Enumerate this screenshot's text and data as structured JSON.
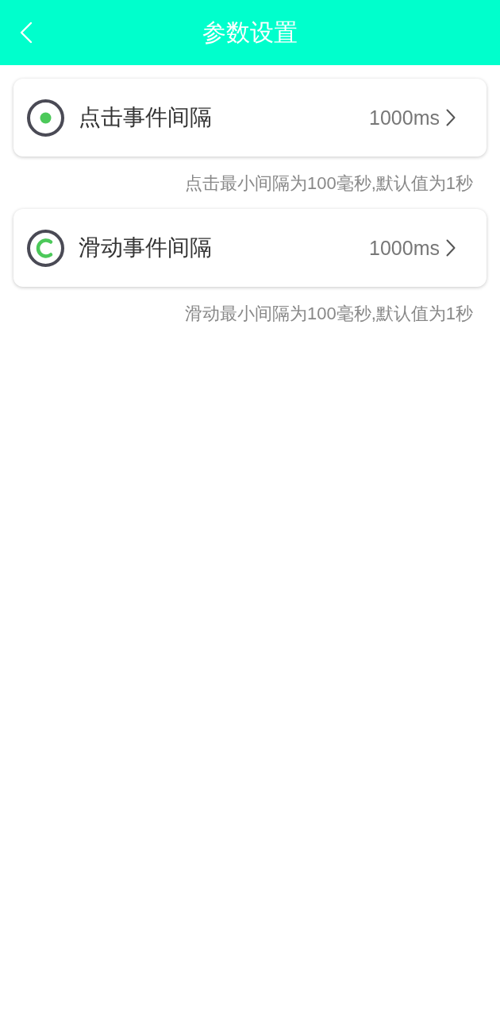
{
  "header": {
    "title": "参数设置"
  },
  "settings": [
    {
      "kind": "tap",
      "label": "点击事件间隔",
      "value": "1000ms",
      "note": "点击最小间隔为100毫秒,默认值为1秒"
    },
    {
      "kind": "swipe",
      "label": "滑动事件间隔",
      "value": "1000ms",
      "note": "滑动最小间隔为100毫秒,默认值为1秒"
    }
  ]
}
